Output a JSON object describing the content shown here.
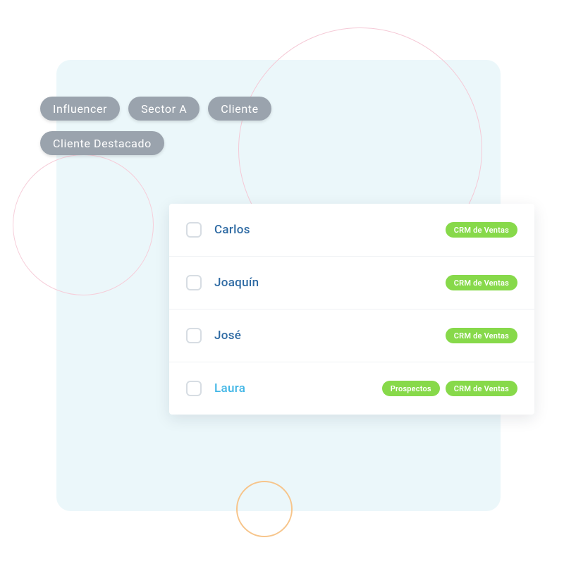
{
  "colors": {
    "panel_bg": "#ebf7fa",
    "tag_bg": "#9aa3ad",
    "pill_bg": "#87d94a",
    "name_color": "#2e6aa3",
    "name_highlight": "#41b6e6"
  },
  "filter_tags_row1": [
    {
      "label": "Influencer"
    },
    {
      "label": "Sector A"
    },
    {
      "label": "Cliente"
    }
  ],
  "filter_tags_row2": [
    {
      "label": "Cliente Destacado"
    }
  ],
  "list": [
    {
      "name": "Carlos",
      "highlight": false,
      "pills": [
        "CRM de Ventas"
      ]
    },
    {
      "name": "Joaquín",
      "highlight": false,
      "pills": [
        "CRM de Ventas"
      ]
    },
    {
      "name": "José",
      "highlight": false,
      "pills": [
        "CRM de Ventas"
      ]
    },
    {
      "name": "Laura",
      "highlight": true,
      "pills": [
        "Prospectos",
        "CRM de Ventas"
      ]
    }
  ]
}
